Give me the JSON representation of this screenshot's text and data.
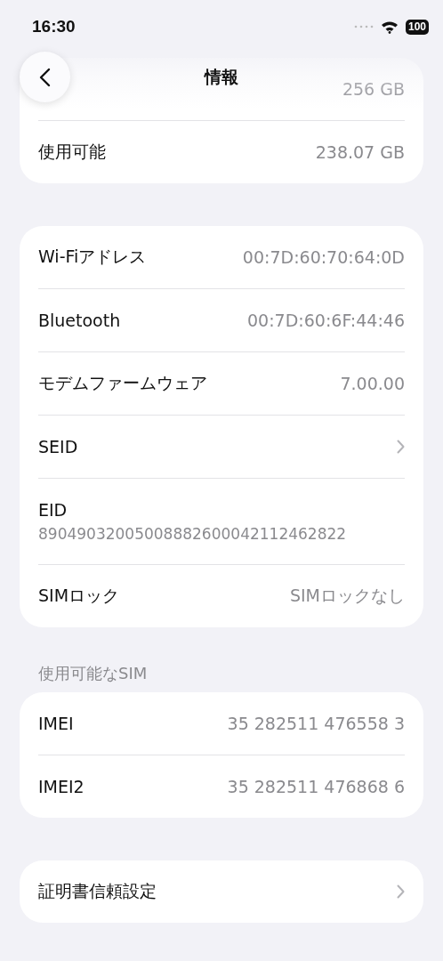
{
  "status_bar": {
    "time": "16:30",
    "battery": "100"
  },
  "nav": {
    "title": "情報"
  },
  "sections": [
    {
      "rows": [
        {
          "kind": "value",
          "value": "256 GB"
        },
        {
          "kind": "value",
          "label": "使用可能",
          "value": "238.07 GB"
        }
      ]
    },
    {
      "rows": [
        {
          "kind": "value",
          "label": "Wi-Fiアドレス",
          "value": "00:7D:60:70:64:0D"
        },
        {
          "kind": "value",
          "label": "Bluetooth",
          "value": "00:7D:60:6F:44:46"
        },
        {
          "kind": "value",
          "label": "モデムファームウェア",
          "value": "7.00.00"
        },
        {
          "kind": "link",
          "label": "SEID"
        },
        {
          "kind": "stacked",
          "label": "EID",
          "value": "89049032005008882600042112462822"
        },
        {
          "kind": "value",
          "label": "SIMロック",
          "value": "SIMロックなし"
        }
      ]
    },
    {
      "header": "使用可能なSIM",
      "rows": [
        {
          "kind": "value",
          "label": "IMEI",
          "value": "35 282511 476558 3"
        },
        {
          "kind": "value",
          "label": "IMEI2",
          "value": "35 282511 476868 6"
        }
      ]
    },
    {
      "rows": [
        {
          "kind": "link",
          "label": "証明書信頼設定"
        }
      ]
    }
  ]
}
